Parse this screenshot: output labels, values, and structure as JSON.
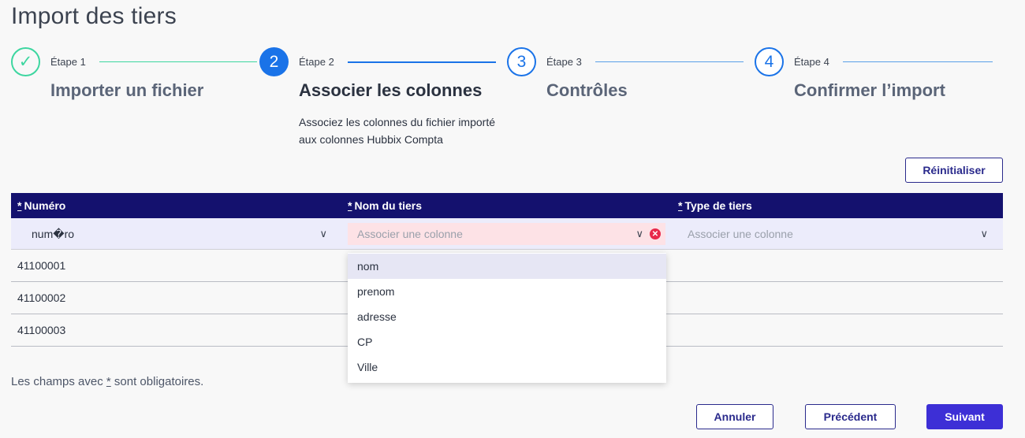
{
  "page": {
    "title": "Import des tiers"
  },
  "stepper": [
    {
      "num": "✓",
      "label": "Étape 1",
      "title": "Importer un fichier",
      "state": "done"
    },
    {
      "num": "2",
      "label": "Étape 2",
      "title": "Associer les colonnes",
      "state": "active",
      "desc": "Associez les colonnes du fichier importé aux colonnes Hubbix Compta"
    },
    {
      "num": "3",
      "label": "Étape 3",
      "title": "Contrôles",
      "state": "todo"
    },
    {
      "num": "4",
      "label": "Étape 4",
      "title": "Confirmer l’import",
      "state": "todo"
    }
  ],
  "reset_label": "Réinitialiser",
  "table": {
    "required_mark": "*",
    "headers": [
      "Numéro",
      "Nom du tiers",
      "Type de tiers"
    ],
    "selectors": [
      {
        "value": "num�ro",
        "placeholder": ""
      },
      {
        "value": "",
        "placeholder": "Associer une colonne"
      },
      {
        "value": "",
        "placeholder": "Associer une colonne"
      }
    ],
    "rows": [
      [
        "41100001",
        "",
        ""
      ],
      [
        "41100002",
        "",
        ""
      ],
      [
        "41100003",
        "",
        ""
      ]
    ]
  },
  "dropdown": {
    "options": [
      "nom",
      "prenom",
      "adresse",
      "CP",
      "Ville"
    ]
  },
  "footnote": {
    "prefix": "Les champs avec ",
    "mark": "*",
    "suffix": " sont obligatoires."
  },
  "actions": {
    "cancel": "Annuler",
    "previous": "Précédent",
    "next": "Suivant"
  },
  "colors": {
    "done": "#3dd6a0",
    "accent": "#1a73e8",
    "header_bg": "#14116e",
    "primary": "#3d2fd6",
    "error": "#e8284a"
  }
}
